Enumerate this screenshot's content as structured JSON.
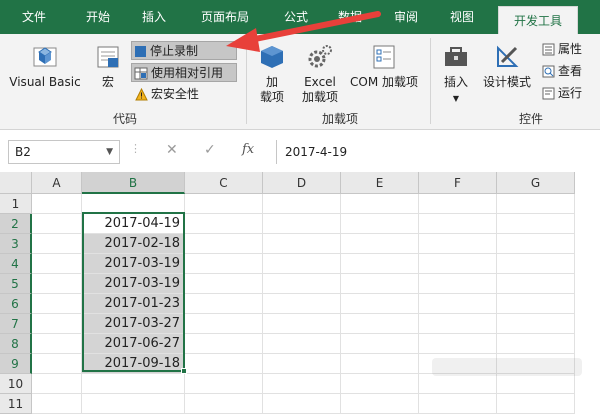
{
  "tabs": [
    {
      "label": "文件"
    },
    {
      "label": "开始"
    },
    {
      "label": "插入"
    },
    {
      "label": "页面布局"
    },
    {
      "label": "公式"
    },
    {
      "label": "数据"
    },
    {
      "label": "审阅"
    },
    {
      "label": "视图"
    },
    {
      "label": "开发工具"
    }
  ],
  "ribbon": {
    "code_group": {
      "label": "代码",
      "visual_basic": "Visual Basic",
      "macros": "宏",
      "stop_recording": "停止录制",
      "use_relative_refs": "使用相对引用",
      "macro_security": "宏安全性"
    },
    "addins_group": {
      "label": "加载项",
      "addins_line1": "加",
      "addins_line2": "载项",
      "excel_addins_line1": "Excel",
      "excel_addins_line2": "加载项",
      "com_addins": "COM 加载项"
    },
    "controls_group": {
      "label": "控件",
      "insert": "插入",
      "design_mode": "设计模式",
      "properties": "属性",
      "view_code": "查看",
      "run_dialog": "运行"
    }
  },
  "formula_bar": {
    "name_box": "B2",
    "cancel_symbol": "✕",
    "enter_symbol": "✓",
    "fx_symbol": "fx",
    "value": "2017-4-19"
  },
  "grid": {
    "columns": [
      "A",
      "B",
      "C",
      "D",
      "E",
      "F",
      "G"
    ],
    "rows": [
      "1",
      "2",
      "3",
      "4",
      "5",
      "6",
      "7",
      "8",
      "9",
      "10",
      "11"
    ],
    "column_b_values": [
      "",
      "2017-04-19",
      "2017-02-18",
      "2017-03-19",
      "2017-03-19",
      "2017-01-23",
      "2017-03-27",
      "2017-06-27",
      "2017-09-18",
      "",
      ""
    ]
  },
  "colors": {
    "accent": "#217346",
    "arrow": "#e8403a"
  }
}
